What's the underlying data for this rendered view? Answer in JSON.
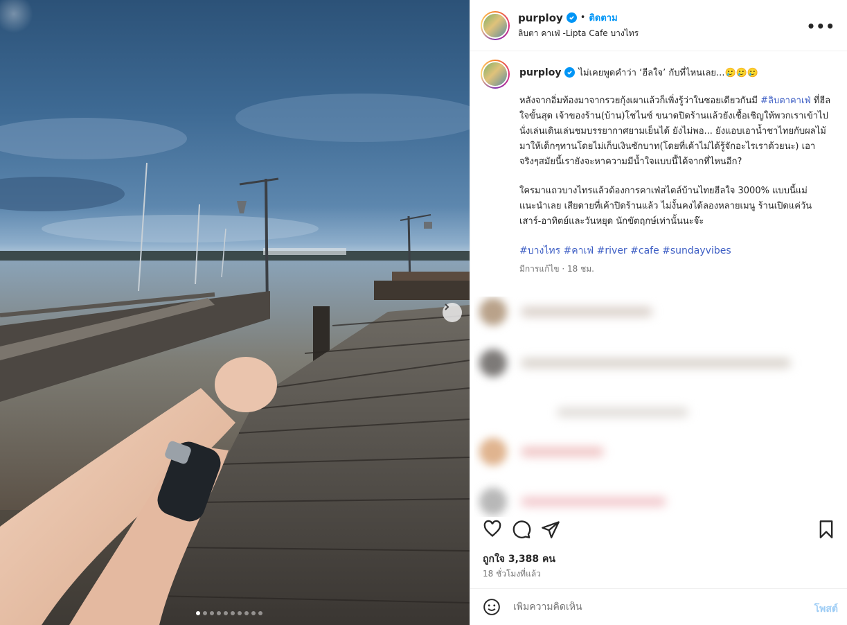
{
  "post": {
    "username": "purploy",
    "follow_label": "ติดตาม",
    "separator": "•",
    "location": "ลิบตา คาเฟ่ -Lipta Cafe บางไทร",
    "more_label": "•••"
  },
  "caption": {
    "username": "purploy",
    "headline": "ไม่เคยพูดคำว่า ‘ฮีลใจ’ กับที่ไหนเลย...🥲🥲🥲",
    "para1_pre": "หลังจากอิ่มท้องมาจากรวยกุ้งเผาแล้วก็เพิ่งรู้ว่าในซอยเดียวกันมี ",
    "para1_link": "#ลิบตาคาเฟ่",
    "para1_post": " ที่ฮีลใจขั้นสุด เจ้าของร้าน(บ้าน)โชไนซ์ ขนาดปิดร้านแล้วยังเชื้อเชิญให้พวกเราเข้าไปนั่งเล่นเดินเล่นชมบรรยากาศยามเย็นได้ ยังไม่พอ... ยังแอบเอาน้ำชาไทยกับผลไม้มาให้เด็กๆทานโดยไม่เก็บเงินซักบาท(โดยที่เค้าไม่ได้รู้จักอะไรเราด้วยนะ) เอาจริงๆสมัยนี้เรายังจะหาความมีน้ำใจแบบนี้ได้จากที่ไหนอีก?",
    "para2": "ใครมาแถวบางไทรแล้วต้องการคาเฟ่สไตล์บ้านไทยฮีลใจ 3000% แบบนี้แม่แนะนำเลย เสียดายที่เค้าปิดร้านแล้ว ไม่งั้นคงได้ลองหลายเมนู ร้านเปิดแค่วันเสาร์-อาทิตย์และวันหยุด นักขัตฤกษ์เท่านั้นนะจ๊ะ",
    "hashtags": "#บางไทร #คาเฟ่ #river #cafe #sundayvibes",
    "meta": "มีการแก้ไข · 18 ชม."
  },
  "stats": {
    "likes": "ถูกใจ 3,388 คน",
    "time_ago": "18 ชั่วโมงที่แล้ว"
  },
  "comment_box": {
    "placeholder": "เพิ่มความคิดเห็น",
    "post_label": "โพสต์"
  },
  "carousel": {
    "count": 10,
    "active_index": 0
  },
  "colors": {
    "accent": "#0095f6",
    "link": "#3d5ec4",
    "muted": "#737373"
  }
}
